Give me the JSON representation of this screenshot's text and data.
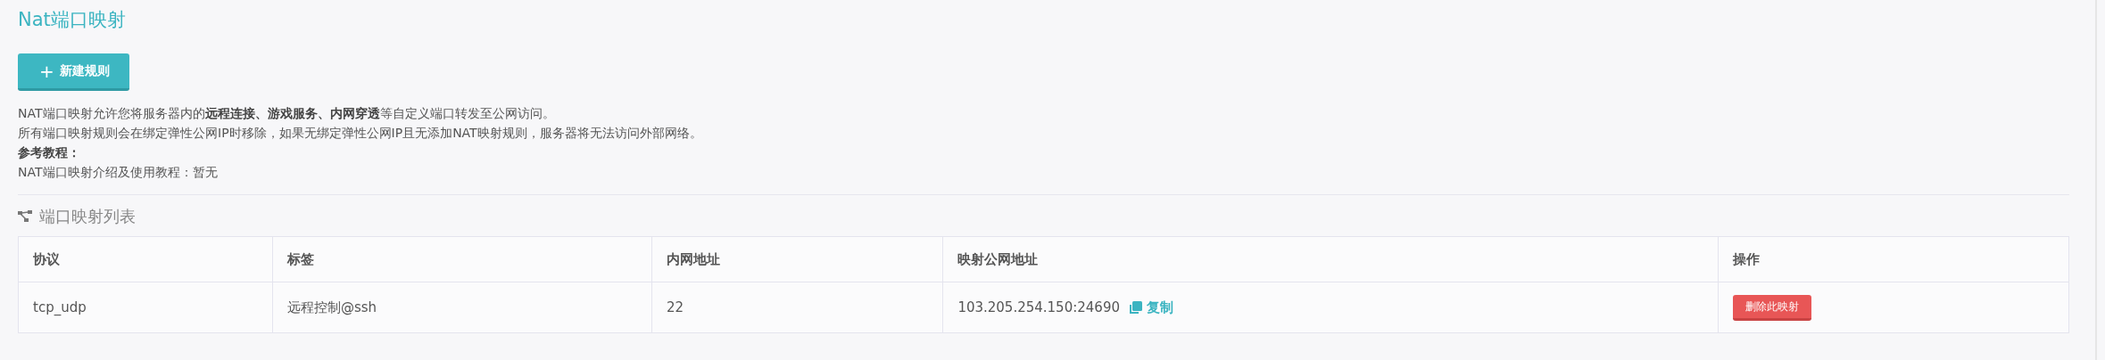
{
  "title": "Nat端口映射",
  "new_button": {
    "icon": "+",
    "label": "新建规则"
  },
  "description": [
    "NAT端口映射允许您将服务器内的**远程连接、游戏服务、内网穿透**等自定义端口转发至公网访问。",
    "所有端口映射规则会在绑定弹性公网IP时移除，如果无绑定弹性公网IP且无添加NAT映射规则，服务器将无法访问外部网络。",
    "**参考教程：**",
    "NAT端口映射介绍及使用教程：暂无"
  ],
  "section_title": "端口映射列表",
  "table": {
    "columns": [
      "协议",
      "标签",
      "内网地址",
      "映射公网地址",
      "操作"
    ],
    "rows": [
      {
        "protocol": "tcp_udp",
        "label": "远程控制@ssh",
        "internal": "22",
        "public": "103.205.254.150:24690",
        "copy": "复制",
        "action": "删除此映射"
      }
    ]
  }
}
